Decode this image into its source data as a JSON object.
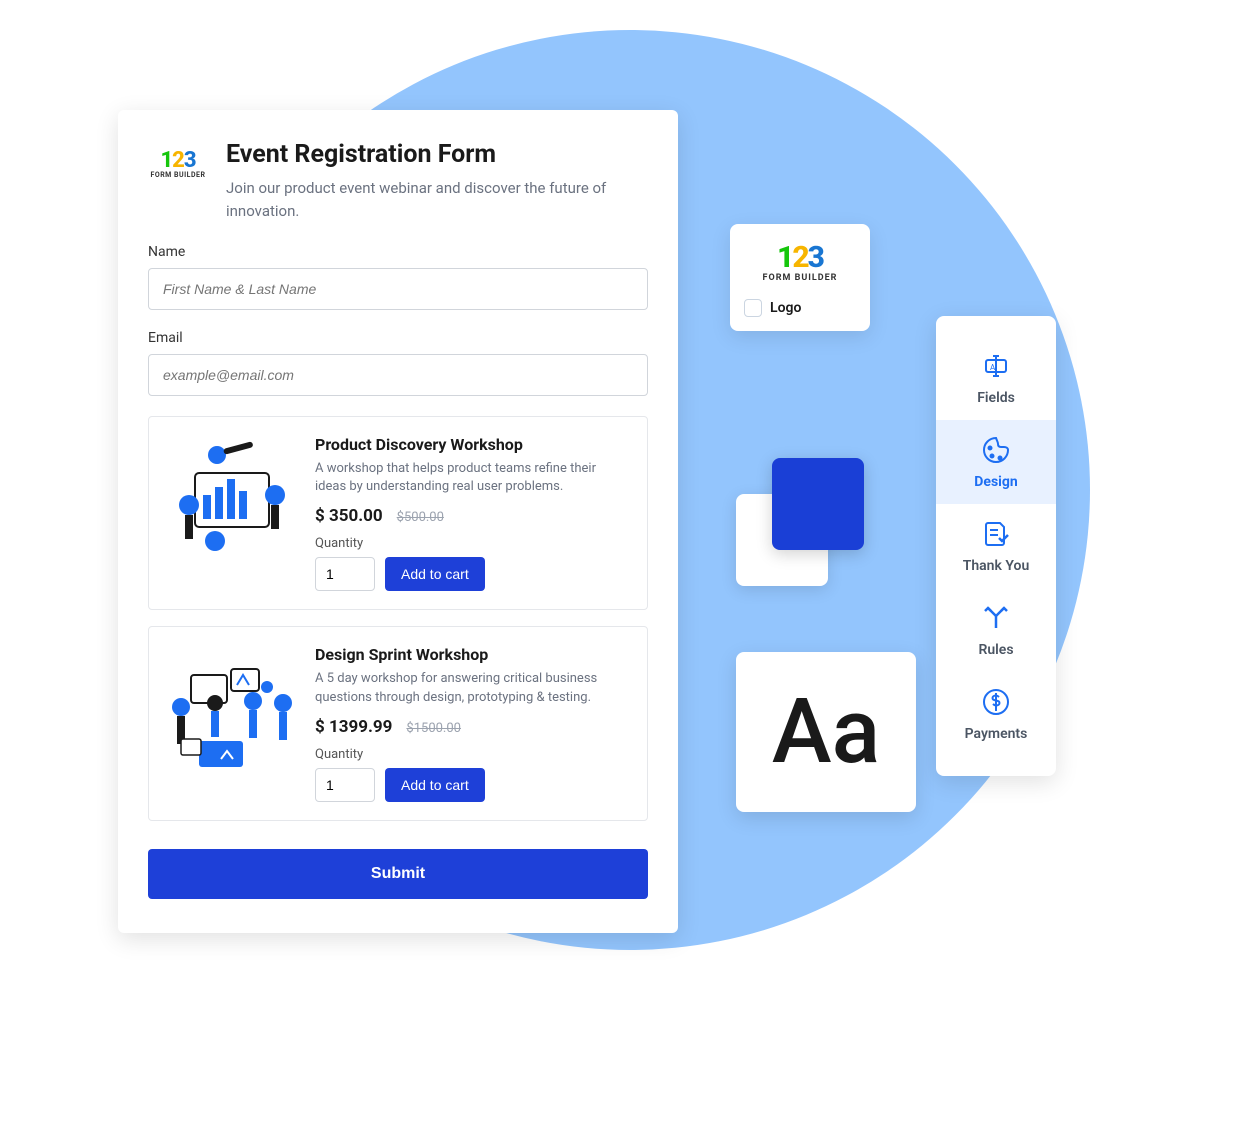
{
  "form": {
    "title": "Event Registration Form",
    "subtitle": "Join our product event webinar and discover the future of innovation.",
    "name_label": "Name",
    "name_placeholder": "First Name & Last Name",
    "email_label": "Email",
    "email_placeholder": "example@email.com",
    "submit_label": "Submit"
  },
  "products": [
    {
      "title": "Product Discovery Workshop",
      "desc": "A workshop that helps product teams refine their ideas by understanding real user problems.",
      "price": "$ 350.00",
      "old_price": "$500.00",
      "qty_label": "Quantity",
      "qty_value": "1",
      "add_label": "Add to cart"
    },
    {
      "title": "Design Sprint Workshop",
      "desc": "A 5 day workshop for answering critical business questions through design, prototyping & testing.",
      "price": "$ 1399.99",
      "old_price": "$1500.00",
      "qty_label": "Quantity",
      "qty_value": "1",
      "add_label": "Add to cart"
    }
  ],
  "logo_card": {
    "brand_sub": "FORM BUILDER",
    "checkbox_label": "Logo"
  },
  "typography": {
    "sample": "Aa"
  },
  "sidebar": {
    "items": [
      {
        "label": "Fields"
      },
      {
        "label": "Design"
      },
      {
        "label": "Thank You"
      },
      {
        "label": "Rules"
      },
      {
        "label": "Payments"
      }
    ]
  }
}
